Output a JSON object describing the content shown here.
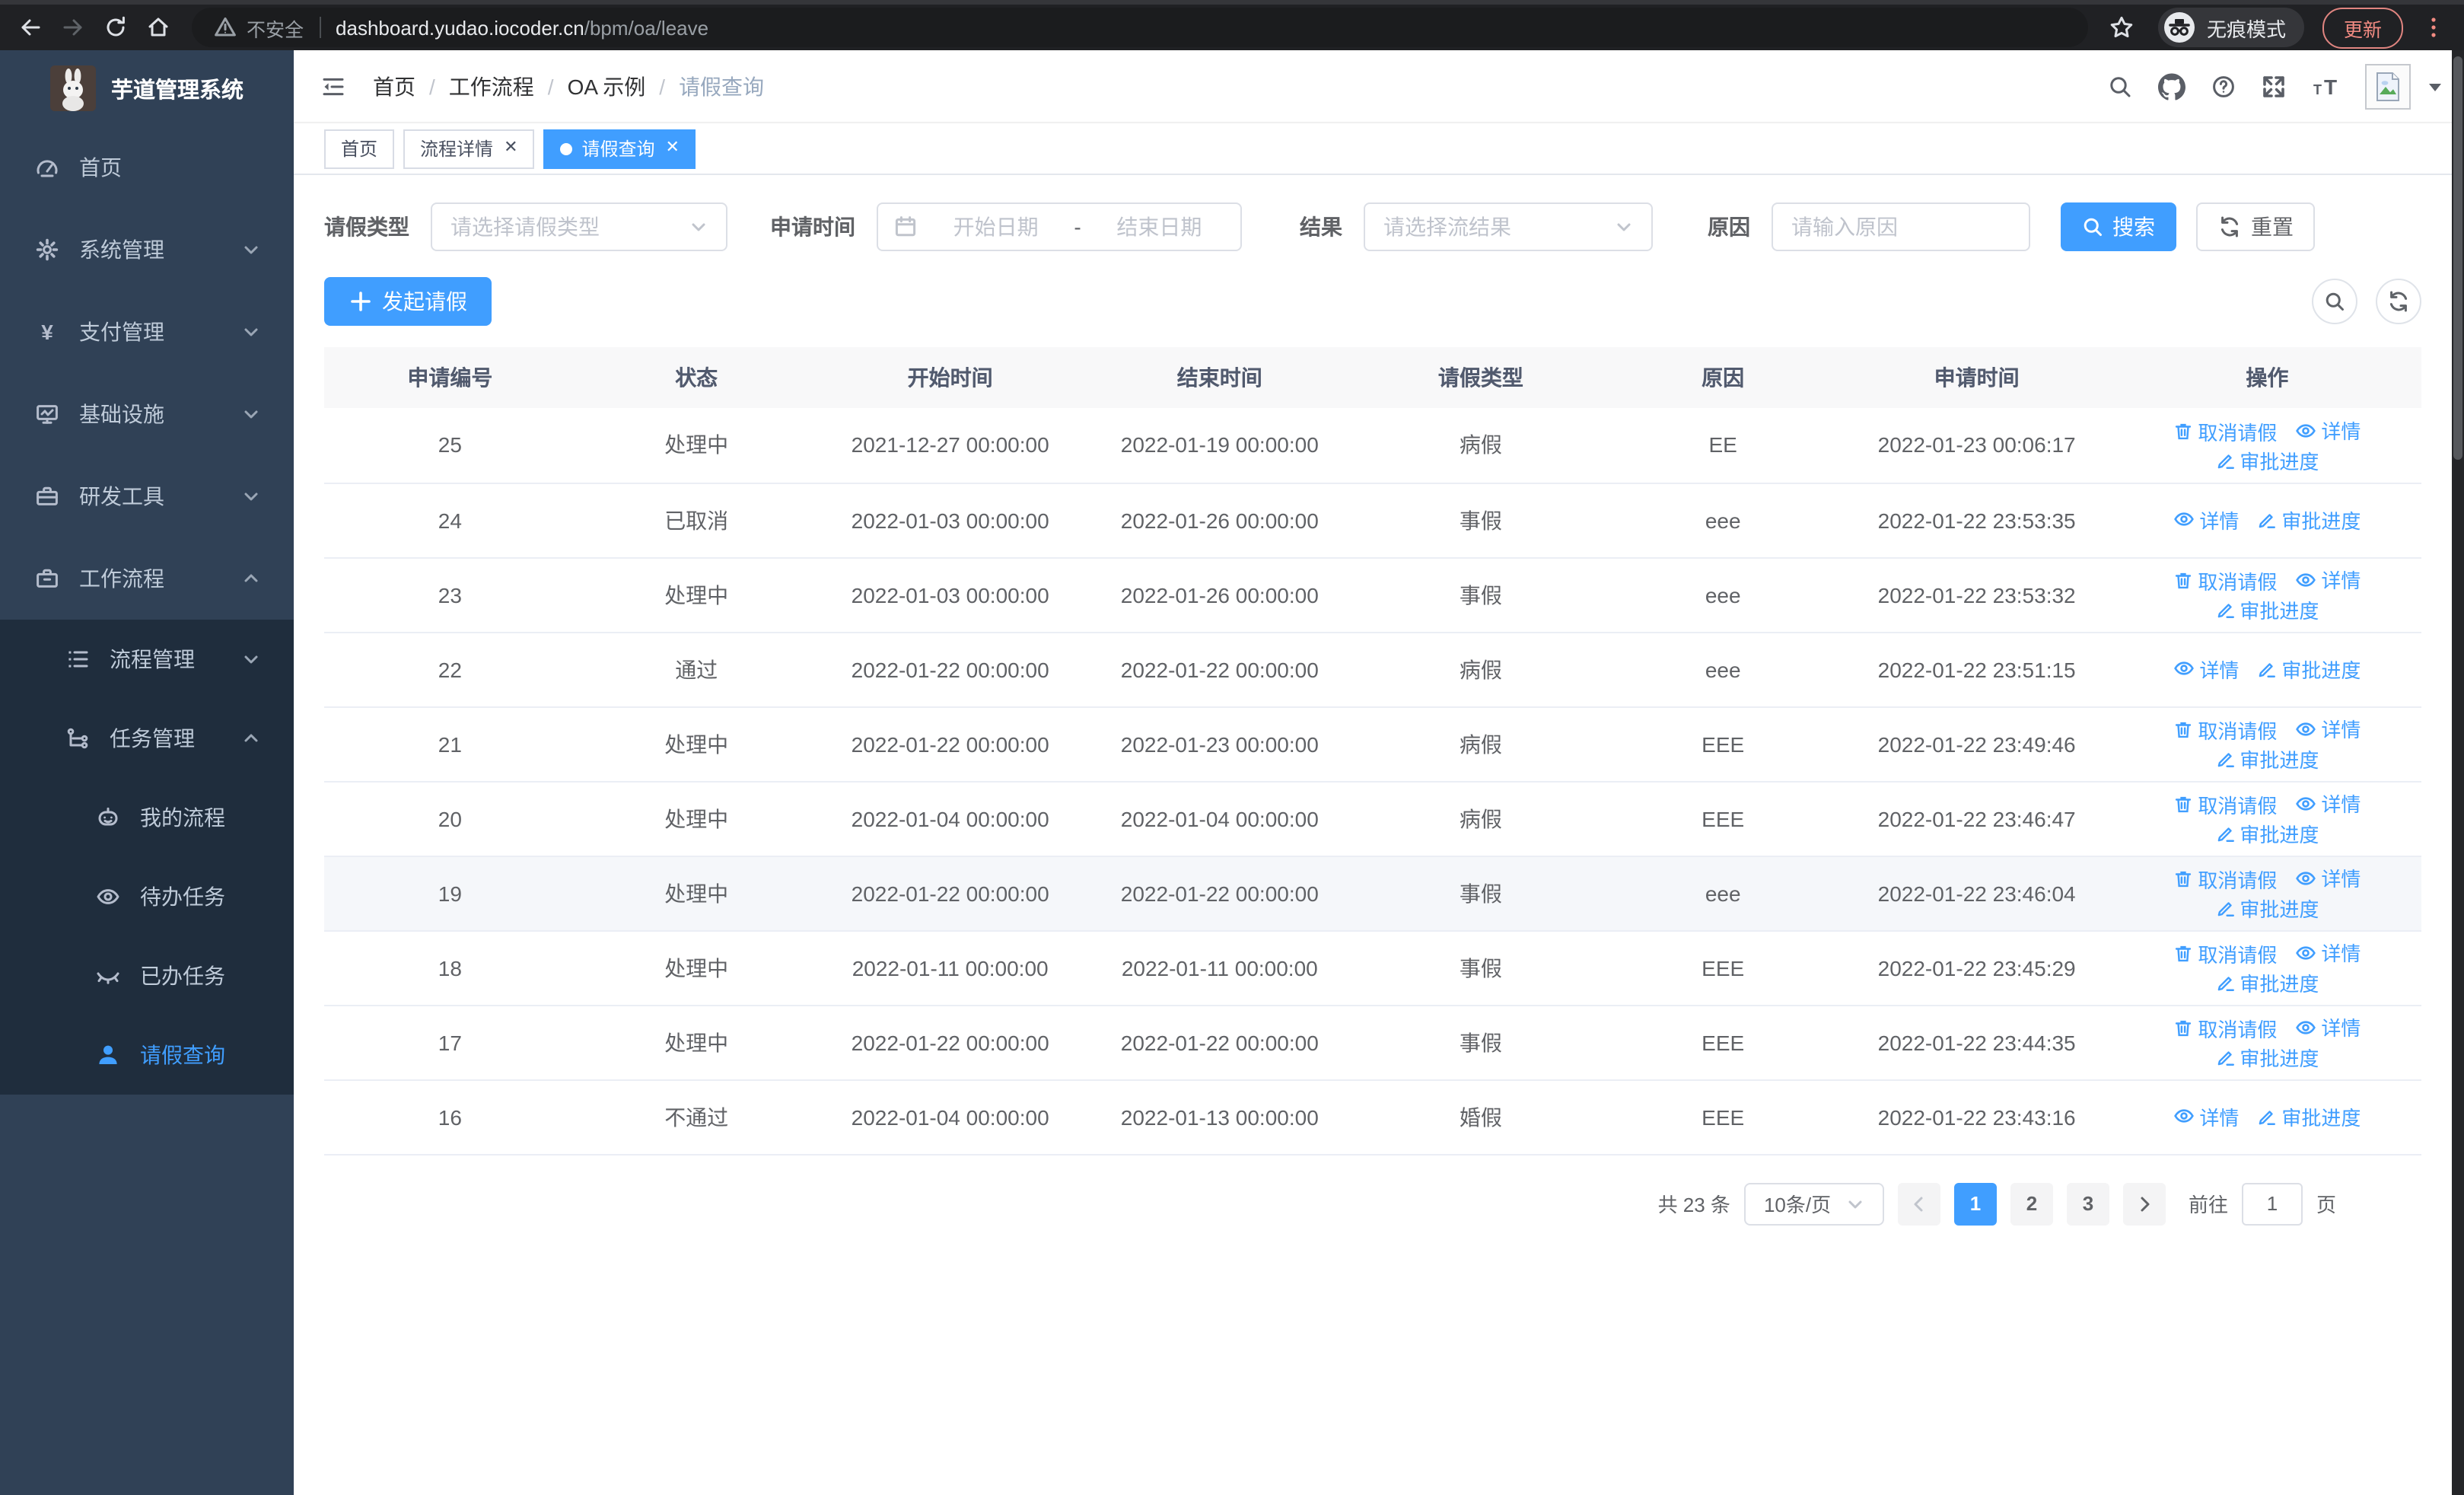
{
  "browser": {
    "security_label": "不安全",
    "url_host": "dashboard.yudao.iocoder.cn",
    "url_path": "/bpm/oa/leave",
    "incognito_label": "无痕模式",
    "update_label": "更新"
  },
  "sidebar": {
    "logo_title": "芋道管理系统",
    "items": [
      {
        "name": "home",
        "label": "首页",
        "icon": "gauge",
        "level": 1,
        "arrow": null,
        "active": false
      },
      {
        "name": "system",
        "label": "系统管理",
        "icon": "gear",
        "level": 1,
        "arrow": "down",
        "active": false
      },
      {
        "name": "payment",
        "label": "支付管理",
        "icon": "yen",
        "level": 1,
        "arrow": "down",
        "active": false
      },
      {
        "name": "infrastructure",
        "label": "基础设施",
        "icon": "monitor",
        "level": 1,
        "arrow": "down",
        "active": false
      },
      {
        "name": "devtools",
        "label": "研发工具",
        "icon": "toolbox",
        "level": 1,
        "arrow": "down",
        "active": false
      },
      {
        "name": "workflow",
        "label": "工作流程",
        "icon": "briefcase",
        "level": 1,
        "arrow": "up",
        "active": false
      },
      {
        "name": "process-mgmt",
        "label": "流程管理",
        "icon": "list",
        "level": 2,
        "arrow": "down",
        "active": false
      },
      {
        "name": "task-mgmt",
        "label": "任务管理",
        "icon": "tree",
        "level": 2,
        "arrow": "up",
        "active": false
      },
      {
        "name": "my-process",
        "label": "我的流程",
        "icon": "robot",
        "level": 3,
        "arrow": null,
        "active": false
      },
      {
        "name": "todo-tasks",
        "label": "待办任务",
        "icon": "eye",
        "level": 3,
        "arrow": null,
        "active": false
      },
      {
        "name": "done-tasks",
        "label": "已办任务",
        "icon": "eye-closed",
        "level": 3,
        "arrow": null,
        "active": false
      },
      {
        "name": "leave-query",
        "label": "请假查询",
        "icon": "user",
        "level": 3,
        "arrow": null,
        "active": true
      }
    ]
  },
  "header": {
    "breadcrumb": [
      {
        "label": "首页",
        "current": false
      },
      {
        "label": "工作流程",
        "current": false
      },
      {
        "label": "OA 示例",
        "current": false
      },
      {
        "label": "请假查询",
        "current": true
      }
    ]
  },
  "tabs": [
    {
      "name": "home",
      "label": "首页",
      "closable": false,
      "active": false
    },
    {
      "name": "process-detail",
      "label": "流程详情",
      "closable": true,
      "active": false
    },
    {
      "name": "leave-query",
      "label": "请假查询",
      "closable": true,
      "active": true
    }
  ],
  "filters": {
    "leave_type_label": "请假类型",
    "leave_type_placeholder": "请选择请假类型",
    "apply_time_label": "申请时间",
    "date_start_placeholder": "开始日期",
    "date_separator": "-",
    "date_end_placeholder": "结束日期",
    "result_label": "结果",
    "result_placeholder": "请选择流结果",
    "reason_label": "原因",
    "reason_placeholder": "请输入原因",
    "search_label": "搜索",
    "reset_label": "重置"
  },
  "toolbar": {
    "create_label": "发起请假"
  },
  "table": {
    "columns": [
      "申请编号",
      "状态",
      "开始时间",
      "结束时间",
      "请假类型",
      "原因",
      "申请时间",
      "操作"
    ],
    "col_widths": [
      "12%",
      "11.5%",
      "12.7%",
      "13%",
      "11.9%",
      "11.2%",
      "13%",
      "14.7%"
    ],
    "action_labels": {
      "cancel": "取消请假",
      "detail": "详情",
      "progress": "审批进度"
    },
    "rows": [
      {
        "id": "25",
        "status": "处理中",
        "start": "2021-12-27 00:00:00",
        "end": "2022-01-19 00:00:00",
        "type": "病假",
        "reason": "EE",
        "apply_time": "2022-01-23 00:06:17",
        "actions": [
          "cancel",
          "detail",
          "progress"
        ],
        "highlight": false
      },
      {
        "id": "24",
        "status": "已取消",
        "start": "2022-01-03 00:00:00",
        "end": "2022-01-26 00:00:00",
        "type": "事假",
        "reason": "eee",
        "apply_time": "2022-01-22 23:53:35",
        "actions": [
          "detail",
          "progress"
        ],
        "highlight": false
      },
      {
        "id": "23",
        "status": "处理中",
        "start": "2022-01-03 00:00:00",
        "end": "2022-01-26 00:00:00",
        "type": "事假",
        "reason": "eee",
        "apply_time": "2022-01-22 23:53:32",
        "actions": [
          "cancel",
          "detail",
          "progress"
        ],
        "highlight": false
      },
      {
        "id": "22",
        "status": "通过",
        "start": "2022-01-22 00:00:00",
        "end": "2022-01-22 00:00:00",
        "type": "病假",
        "reason": "eee",
        "apply_time": "2022-01-22 23:51:15",
        "actions": [
          "detail",
          "progress"
        ],
        "highlight": false
      },
      {
        "id": "21",
        "status": "处理中",
        "start": "2022-01-22 00:00:00",
        "end": "2022-01-23 00:00:00",
        "type": "病假",
        "reason": "EEE",
        "apply_time": "2022-01-22 23:49:46",
        "actions": [
          "cancel",
          "detail",
          "progress"
        ],
        "highlight": false
      },
      {
        "id": "20",
        "status": "处理中",
        "start": "2022-01-04 00:00:00",
        "end": "2022-01-04 00:00:00",
        "type": "病假",
        "reason": "EEE",
        "apply_time": "2022-01-22 23:46:47",
        "actions": [
          "cancel",
          "detail",
          "progress"
        ],
        "highlight": false
      },
      {
        "id": "19",
        "status": "处理中",
        "start": "2022-01-22 00:00:00",
        "end": "2022-01-22 00:00:00",
        "type": "事假",
        "reason": "eee",
        "apply_time": "2022-01-22 23:46:04",
        "actions": [
          "cancel",
          "detail",
          "progress"
        ],
        "highlight": true
      },
      {
        "id": "18",
        "status": "处理中",
        "start": "2022-01-11 00:00:00",
        "end": "2022-01-11 00:00:00",
        "type": "事假",
        "reason": "EEE",
        "apply_time": "2022-01-22 23:45:29",
        "actions": [
          "cancel",
          "detail",
          "progress"
        ],
        "highlight": false
      },
      {
        "id": "17",
        "status": "处理中",
        "start": "2022-01-22 00:00:00",
        "end": "2022-01-22 00:00:00",
        "type": "事假",
        "reason": "EEE",
        "apply_time": "2022-01-22 23:44:35",
        "actions": [
          "cancel",
          "detail",
          "progress"
        ],
        "highlight": false
      },
      {
        "id": "16",
        "status": "不通过",
        "start": "2022-01-04 00:00:00",
        "end": "2022-01-13 00:00:00",
        "type": "婚假",
        "reason": "EEE",
        "apply_time": "2022-01-22 23:43:16",
        "actions": [
          "detail",
          "progress"
        ],
        "highlight": false
      }
    ]
  },
  "pagination": {
    "total_label": "共 23 条",
    "page_size_value": "10条/页",
    "pages": [
      "1",
      "2",
      "3"
    ],
    "active_page": "1",
    "goto_label": "前往",
    "goto_value": "1",
    "goto_suffix": "页"
  },
  "colors": {
    "accent": "#409eff",
    "sidebar_bg": "#304156",
    "submenu_bg": "#1f2d3d"
  }
}
